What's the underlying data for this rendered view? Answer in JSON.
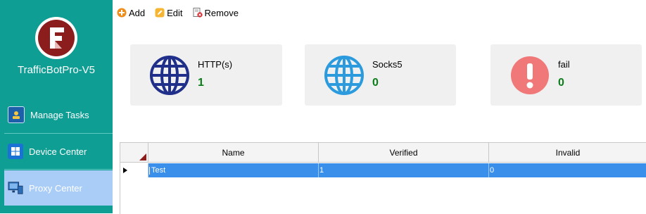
{
  "app": {
    "title": "TrafficBotPro-V5"
  },
  "sidebar": {
    "items": [
      {
        "label": "Manage Tasks",
        "icon": "user-badge-icon"
      },
      {
        "label": "Device Center",
        "icon": "windows-icon"
      },
      {
        "label": "Proxy Center",
        "icon": "proxy-monitor-icon",
        "active": true
      }
    ]
  },
  "toolbar": {
    "add_label": "Add",
    "edit_label": "Edit",
    "remove_label": "Remove"
  },
  "stats": [
    {
      "label": "HTTP(s)",
      "value": "1",
      "icon": "globe-icon",
      "color": "#1f2f8a"
    },
    {
      "label": "Socks5",
      "value": "0",
      "icon": "globe-icon",
      "color": "#2b9bde"
    },
    {
      "label": "fail",
      "value": "0",
      "icon": "exclamation-icon",
      "color": "#f07878"
    }
  ],
  "grid": {
    "columns": [
      "Name",
      "Verified",
      "Invalid"
    ],
    "rows": [
      {
        "name": "Test",
        "verified": "1",
        "invalid": "0",
        "selected": true
      }
    ]
  },
  "colors": {
    "sidebar": "#0e9e94",
    "active_item": "#a9cdf7",
    "selected_row": "#3a8fea",
    "stat_value": "#0a7d1a"
  }
}
